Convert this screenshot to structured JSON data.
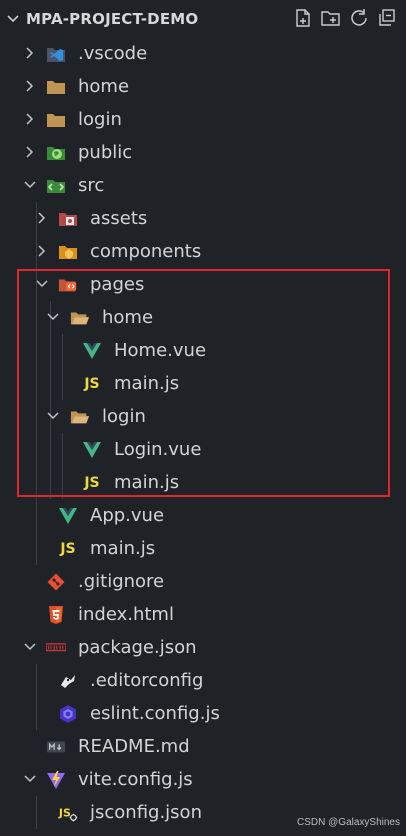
{
  "header": {
    "title": "MPA-PROJECT-DEMO"
  },
  "items": [
    {
      "label": ".vscode",
      "icon": "vscode-folder-icon",
      "kind": "folder-closed"
    },
    {
      "label": "home",
      "icon": "folder-icon",
      "kind": "folder-closed"
    },
    {
      "label": "login",
      "icon": "folder-icon",
      "kind": "folder-closed"
    },
    {
      "label": "public",
      "icon": "public-folder-icon",
      "kind": "folder-closed"
    },
    {
      "label": "src",
      "icon": "src-folder-icon",
      "kind": "folder-open"
    },
    {
      "label": "assets",
      "icon": "assets-folder-icon",
      "kind": "folder-closed"
    },
    {
      "label": "components",
      "icon": "components-folder-icon",
      "kind": "folder-closed"
    },
    {
      "label": "pages",
      "icon": "pages-folder-icon",
      "kind": "folder-open"
    },
    {
      "label": "home",
      "icon": "folder-open-icon",
      "kind": "folder-open"
    },
    {
      "label": "Home.vue",
      "icon": "vue-icon",
      "kind": "file"
    },
    {
      "label": "main.js",
      "icon": "js-icon",
      "kind": "file"
    },
    {
      "label": "login",
      "icon": "folder-open-icon",
      "kind": "folder-open"
    },
    {
      "label": "Login.vue",
      "icon": "vue-icon",
      "kind": "file"
    },
    {
      "label": "main.js",
      "icon": "js-icon",
      "kind": "file"
    },
    {
      "label": "App.vue",
      "icon": "vue-icon",
      "kind": "file"
    },
    {
      "label": "main.js",
      "icon": "js-icon",
      "kind": "file"
    },
    {
      "label": ".gitignore",
      "icon": "git-icon",
      "kind": "file"
    },
    {
      "label": "index.html",
      "icon": "html5-icon",
      "kind": "file"
    },
    {
      "label": "package.json",
      "icon": "npm-icon",
      "kind": "file-expanded"
    },
    {
      "label": ".editorconfig",
      "icon": "editorconfig-icon",
      "kind": "file"
    },
    {
      "label": "eslint.config.js",
      "icon": "eslint-icon",
      "kind": "file"
    },
    {
      "label": "README.md",
      "icon": "markdown-icon",
      "kind": "file"
    },
    {
      "label": "vite.config.js",
      "icon": "vite-icon",
      "kind": "file-expanded"
    },
    {
      "label": "jsconfig.json",
      "icon": "jsconfig-icon",
      "kind": "file"
    }
  ],
  "js_badge": "JS",
  "watermark": "CSDN @GalaxyShines",
  "colors": {
    "background": "#1f2227",
    "highlight_border": "#e0262e",
    "vue_green": "#41b883",
    "js_yellow": "#f0d83b",
    "folder_tan": "#c09553"
  }
}
